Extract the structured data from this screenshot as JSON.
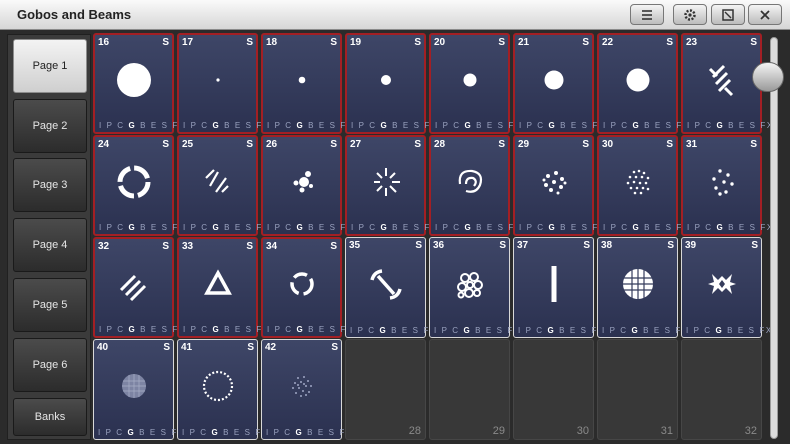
{
  "window": {
    "title": "Gobos and Beams"
  },
  "toolbar": {
    "icons": [
      "menu-icon",
      "gear-icon",
      "restore-icon",
      "close-icon"
    ]
  },
  "sidebar": {
    "items": [
      {
        "label": "Page 1",
        "active": true
      },
      {
        "label": "Page 2",
        "active": false
      },
      {
        "label": "Page 3",
        "active": false
      },
      {
        "label": "Page 4",
        "active": false
      },
      {
        "label": "Page 5",
        "active": false
      },
      {
        "label": "Page 6",
        "active": false
      },
      {
        "label": "Banks",
        "active": false
      }
    ]
  },
  "footer": {
    "letters": [
      "I",
      "P",
      "C",
      "G",
      "B",
      "E",
      "S",
      "FX"
    ],
    "highlight": "G"
  },
  "colors": {
    "border_red": "#a31f24",
    "border_white": "#d8d8d8",
    "tile_bg": "#353c5c"
  },
  "cells": [
    {
      "number": "16",
      "tag": "S",
      "icon": "large-circle-icon",
      "border": "red"
    },
    {
      "number": "17",
      "tag": "S",
      "icon": "tiny-dot-icon",
      "border": "red"
    },
    {
      "number": "18",
      "tag": "S",
      "icon": "small-dot-icon",
      "border": "red"
    },
    {
      "number": "19",
      "tag": "S",
      "icon": "dot-icon",
      "border": "red"
    },
    {
      "number": "20",
      "tag": "S",
      "icon": "medium-dot-icon",
      "border": "red"
    },
    {
      "number": "21",
      "tag": "S",
      "icon": "medium-circle-icon",
      "border": "red"
    },
    {
      "number": "22",
      "tag": "S",
      "icon": "circle-icon",
      "border": "red"
    },
    {
      "number": "23",
      "tag": "S",
      "icon": "slashes-icon",
      "border": "red"
    },
    {
      "number": "24",
      "tag": "S",
      "icon": "ring-segments-icon",
      "border": "red"
    },
    {
      "number": "25",
      "tag": "S",
      "icon": "broken-lines-icon",
      "border": "red"
    },
    {
      "number": "26",
      "tag": "S",
      "icon": "dot-cluster-icon",
      "border": "red"
    },
    {
      "number": "27",
      "tag": "S",
      "icon": "starburst-icon",
      "border": "red"
    },
    {
      "number": "28",
      "tag": "S",
      "icon": "swirl-icon",
      "border": "red"
    },
    {
      "number": "29",
      "tag": "S",
      "icon": "speckle-circle-icon",
      "border": "red"
    },
    {
      "number": "30",
      "tag": "S",
      "icon": "dots-circle-icon",
      "border": "red"
    },
    {
      "number": "31",
      "tag": "S",
      "icon": "scattered-dots-icon",
      "border": "red"
    },
    {
      "number": "32",
      "tag": "S",
      "icon": "diagonal-bars-icon",
      "border": "red"
    },
    {
      "number": "33",
      "tag": "S",
      "icon": "triangle-icon",
      "border": "red"
    },
    {
      "number": "34",
      "tag": "S",
      "icon": "split-ring-icon",
      "border": "red"
    },
    {
      "number": "35",
      "tag": "S",
      "icon": "anchor-bar-icon",
      "border": "white"
    },
    {
      "number": "36",
      "tag": "S",
      "icon": "foliage-icon",
      "border": "white"
    },
    {
      "number": "37",
      "tag": "S",
      "icon": "vertical-bar-icon",
      "border": "white"
    },
    {
      "number": "38",
      "tag": "S",
      "icon": "cells-circle-icon",
      "border": "white"
    },
    {
      "number": "39",
      "tag": "S",
      "icon": "star-burst-icon",
      "border": "white"
    },
    {
      "number": "40",
      "tag": "S",
      "icon": "mesh-circle-icon",
      "border": "white"
    },
    {
      "number": "41",
      "tag": "S",
      "icon": "dotted-ring-icon",
      "border": "white"
    },
    {
      "number": "42",
      "tag": "S",
      "icon": "noise-circle-icon",
      "border": "white"
    }
  ],
  "empty_slots": [
    "28",
    "29",
    "30",
    "31",
    "32"
  ]
}
